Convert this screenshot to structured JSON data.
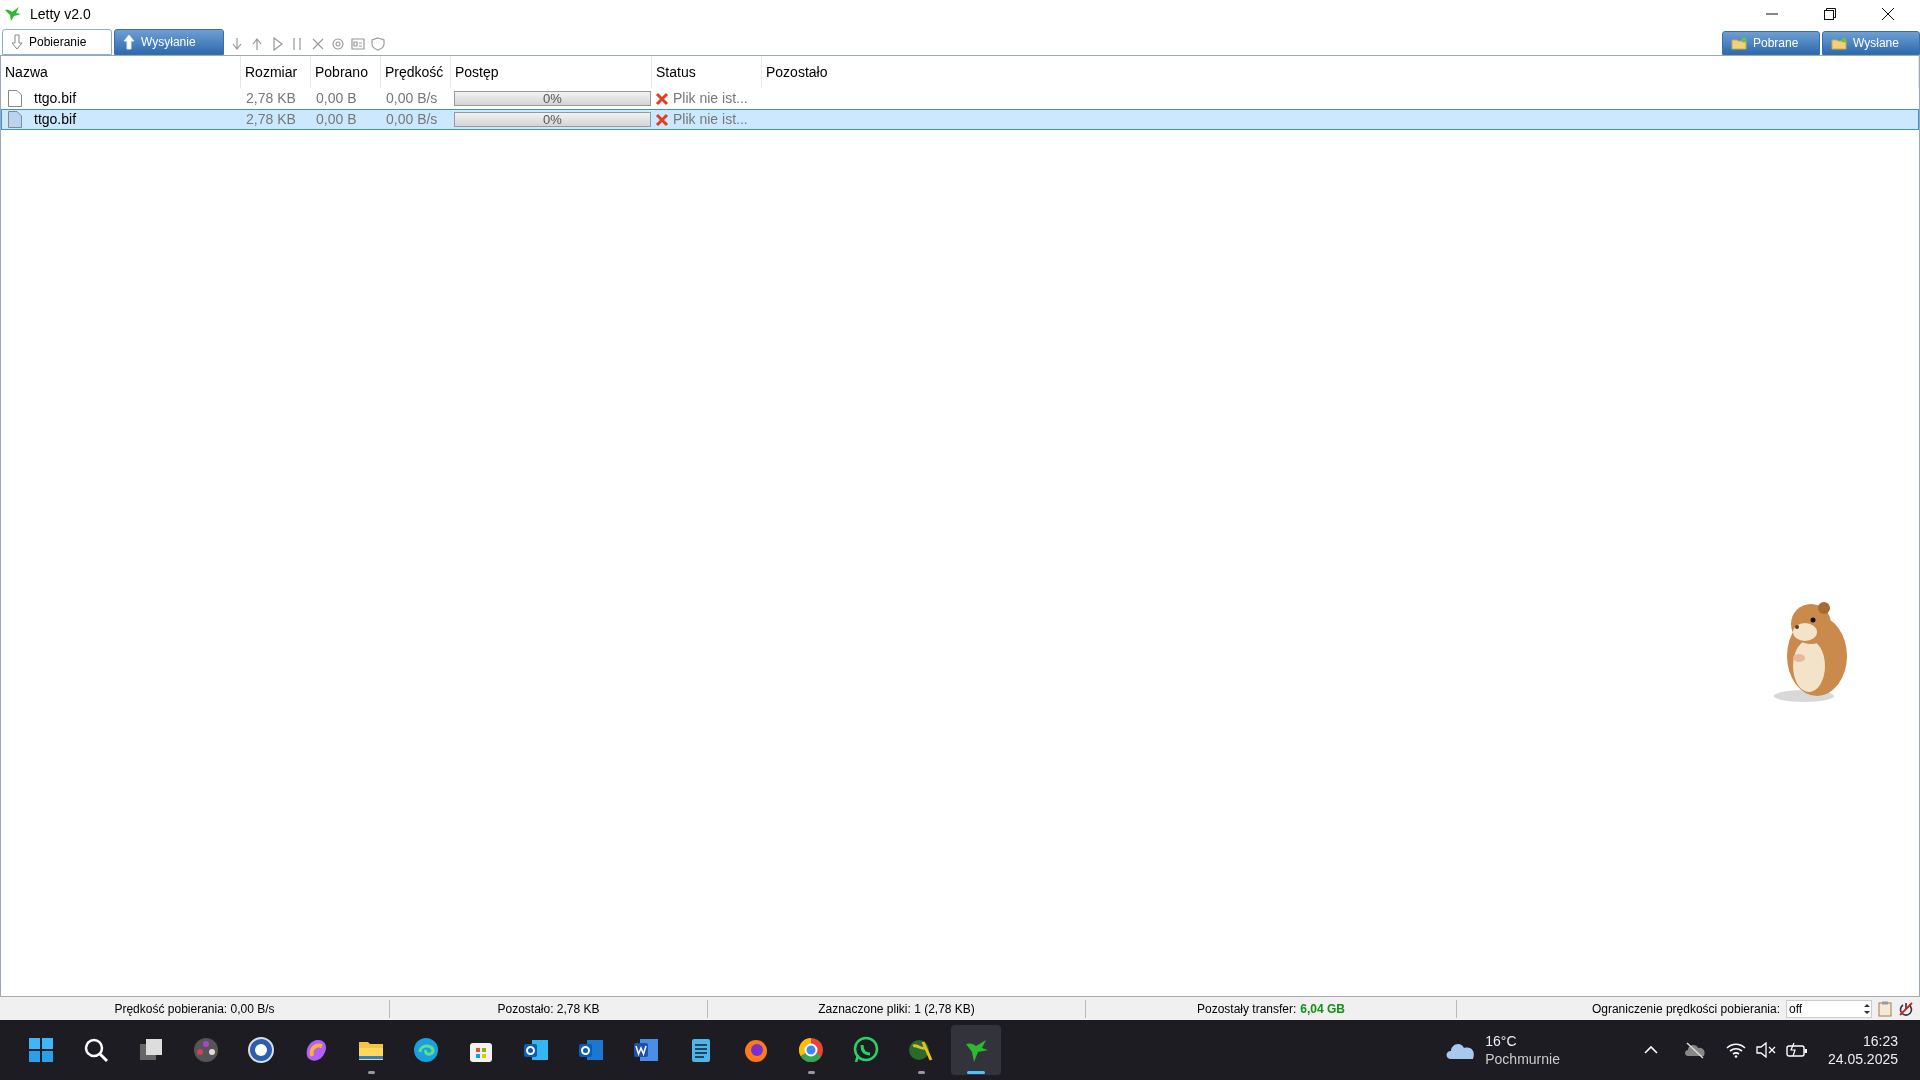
{
  "window": {
    "title": "Letty v2.0"
  },
  "tabs": [
    {
      "label": "Pobieranie",
      "selected": true
    },
    {
      "label": "Wysyłanie",
      "selected": false
    }
  ],
  "folder_tabs": [
    {
      "label": "Pobrane"
    },
    {
      "label": "Wysłane"
    }
  ],
  "table": {
    "columns": [
      "Nazwa",
      "Rozmiar",
      "Pobrano",
      "Prędkość",
      "Postęp",
      "Status",
      "Pozostało"
    ],
    "rows": [
      {
        "name": "ttgo.bif",
        "size": "2,78 KB",
        "downloaded": "0,00 B",
        "speed": "0,00 B/s",
        "level": 0,
        "progress": "0%",
        "status": "Plik nie ist...",
        "selected": false
      },
      {
        "name": "ttgo.bif",
        "size": "2,78 KB",
        "downloaded": "0,00 B",
        "speed": "0,00 B/s",
        "level": 0,
        "progress": "0%",
        "status": "Plik nie ist...",
        "selected": true
      }
    ]
  },
  "status_bar": {
    "speed": "Prędkość pobierania: 0,00 B/s",
    "remaining": "Pozostało: 2,78 KB",
    "selected_files": "Zaznaczone pliki: 1 (2,78 KB)",
    "transfer_label": "Pozostały transfer:",
    "transfer_value": "6,04 GB",
    "limit_label": "Ograniczenie prędkości pobierania:",
    "limit_value": "off"
  },
  "taskbar": {
    "apps": [
      {
        "running": false,
        "selected": false
      },
      {
        "running": false,
        "selected": false
      },
      {
        "running": false,
        "selected": false
      },
      {
        "running": false,
        "selected": false
      },
      {
        "running": false,
        "selected": false
      },
      {
        "running": false,
        "selected": false
      },
      {
        "running": true,
        "selected": false
      },
      {
        "running": false,
        "selected": false
      },
      {
        "running": false,
        "selected": false
      },
      {
        "running": false,
        "selected": false
      },
      {
        "running": false,
        "selected": false
      },
      {
        "running": false,
        "selected": false
      },
      {
        "running": false,
        "selected": false
      },
      {
        "running": false,
        "selected": false
      },
      {
        "running": true,
        "selected": false
      },
      {
        "running": false,
        "selected": false
      },
      {
        "running": true,
        "selected": false
      },
      {
        "running": true,
        "selected": true
      }
    ],
    "weather": {
      "temperature": "16°C",
      "condition": "Pochmurnie"
    },
    "clock": {
      "time": "16:23",
      "date": "24.05.2025"
    }
  }
}
